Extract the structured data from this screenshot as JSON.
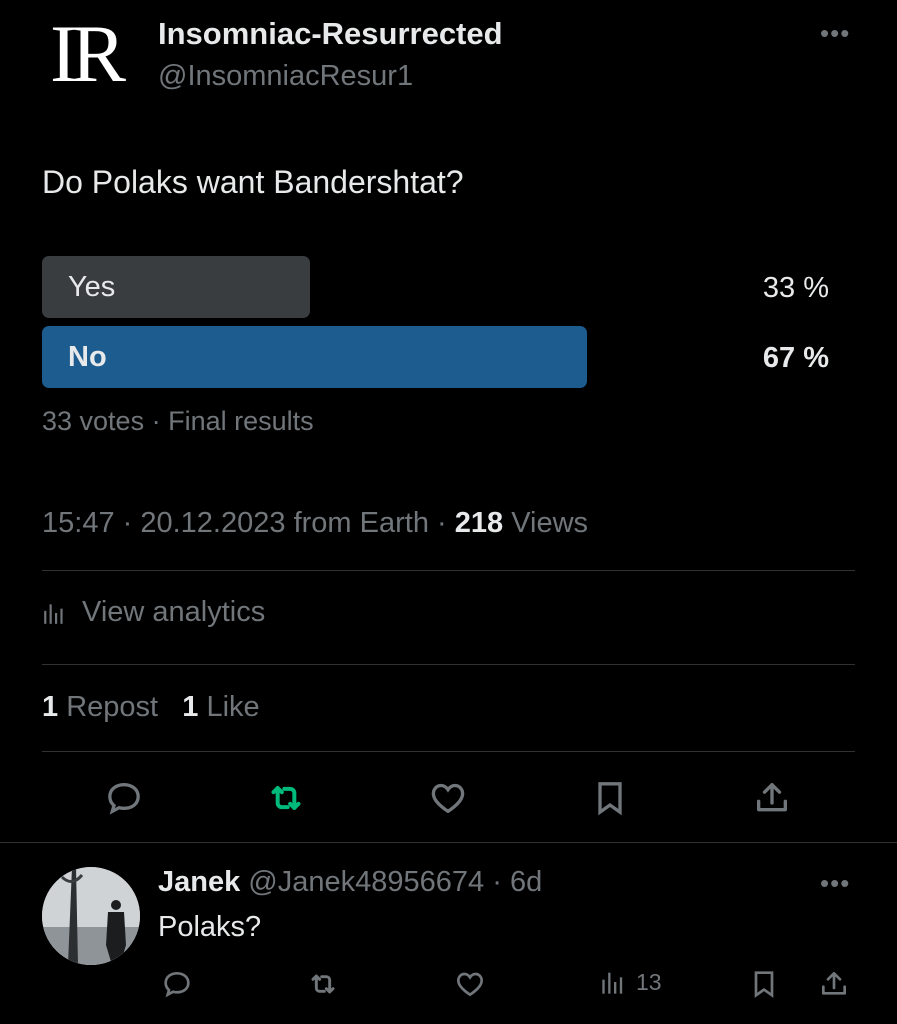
{
  "author": {
    "logo": "IR",
    "display_name": "Insomniac-Resurrected",
    "handle": "@InsomniacResur1",
    "more_icon": "more-horizontal-icon"
  },
  "tweet": {
    "question": "Do Polaks want Bandershtat?",
    "poll": {
      "options": [
        {
          "label": "Yes",
          "percent_text": "33 %",
          "percent": 33,
          "winner": false
        },
        {
          "label": "No",
          "percent_text": "67 %",
          "percent": 67,
          "winner": true
        }
      ],
      "votes": "33 votes",
      "status": "Final results"
    },
    "time": "15:47",
    "date": "20.12.2023",
    "source": "from Earth",
    "views_count": "218",
    "views_label": "Views",
    "analytics_label": "View analytics",
    "reposts_count": "1",
    "reposts_label": "Repost",
    "likes_count": "1",
    "likes_label": "Like"
  },
  "reply": {
    "name": "Janek",
    "handle": "@Janek48956674",
    "age": "6d",
    "text": "Polaks?",
    "views": "13"
  },
  "colors": {
    "accent_blue": "#1d5c8f",
    "bar_gray": "#3a3d40",
    "repost_green": "#00ba7c",
    "muted": "#71767b"
  }
}
